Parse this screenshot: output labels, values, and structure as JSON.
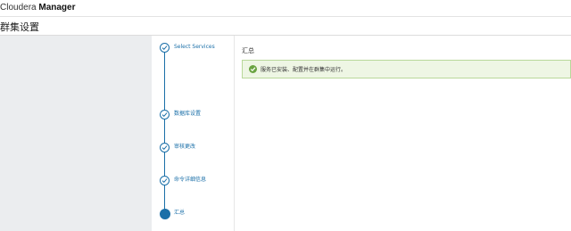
{
  "header": {
    "brand_light": "Cloudera",
    "brand_bold": "Manager"
  },
  "page": {
    "title": "群集设置"
  },
  "wizard": {
    "steps": [
      {
        "label": "Select Services",
        "state": "done"
      },
      {
        "label": "数据库设置",
        "state": "done"
      },
      {
        "label": "审核更改",
        "state": "done"
      },
      {
        "label": "命令详细信息",
        "state": "done"
      },
      {
        "label": "汇总",
        "state": "active"
      }
    ]
  },
  "main": {
    "section_title": "汇总",
    "alert_message": "服务已安装、配置并在群集中运行。"
  },
  "colors": {
    "accent": "#1a6fa8",
    "success": "#6aa441"
  }
}
